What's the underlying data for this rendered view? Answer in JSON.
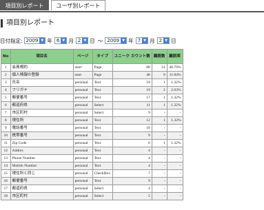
{
  "tabs": [
    {
      "label": "項目別レポート"
    },
    {
      "label": "ユーザ別レポート"
    }
  ],
  "page_title": "項目別レポート",
  "date_filter": {
    "label": "日付指定:",
    "from": {
      "year": "2009",
      "month": "6",
      "day": "2"
    },
    "separator": "～",
    "to": {
      "year": "2009",
      "month": "7",
      "day": "2"
    },
    "unit_year": "年",
    "unit_month": "月",
    "unit_day": "日"
  },
  "table": {
    "headers": [
      "No",
      "項目名",
      "ページ",
      "タイプ",
      "ユニーク カウント数",
      "離脱数",
      "離脱率"
    ],
    "rows": [
      [
        "1",
        "会員規約",
        "start",
        "Page",
        "88",
        "31",
        "40.79%"
      ],
      [
        "2",
        "個人情報の登録",
        "start",
        "Page",
        "46",
        "9",
        "11.84%"
      ],
      [
        "3",
        "氏名",
        "personal",
        "Text",
        "19",
        "1",
        "1.32%"
      ],
      [
        "4",
        "フリガナ",
        "personal",
        "Text",
        "19",
        "2",
        "2.63%"
      ],
      [
        "5",
        "郵便番号",
        "personal",
        "Text",
        "17",
        "1",
        "1.32%"
      ],
      [
        "6",
        "都道府県",
        "personal",
        "Select",
        "11",
        "1",
        "1.32%"
      ],
      [
        "7",
        "市区町村",
        "personal",
        "Select",
        "9",
        "-",
        "-"
      ],
      [
        "8",
        "現住所",
        "personal",
        "Text",
        "12",
        "1",
        "1.32%"
      ],
      [
        "9",
        "電話番号",
        "personal",
        "Text",
        "10",
        "-",
        "-"
      ],
      [
        "10",
        "携帯番号",
        "personal",
        "Text",
        "9",
        "-",
        "-"
      ],
      [
        "11",
        "Zip Code",
        "personal",
        "Text",
        "6",
        "1",
        "1.32%"
      ],
      [
        "12",
        "Addres",
        "personal",
        "Text",
        "4",
        "-",
        "-"
      ],
      [
        "13",
        "Phone Number",
        "personal",
        "Text",
        "4",
        "-",
        "-"
      ],
      [
        "14",
        "Mobile Number",
        "personal",
        "Text",
        "4",
        "-",
        "-"
      ],
      [
        "15",
        "現住所と同じ",
        "personal",
        "CheckBox",
        "7",
        "-",
        "-"
      ],
      [
        "16",
        "郵便番号",
        "personal",
        "Text",
        "9",
        "-",
        "-"
      ],
      [
        "17",
        "都道府県",
        "personal",
        "Select",
        "4",
        "-",
        "-"
      ],
      [
        "18",
        "市区町村",
        "personal",
        "Select",
        "5",
        "-",
        "-"
      ]
    ]
  },
  "colors": {
    "header_green": "#8dd08d",
    "active_tab": "#595959",
    "select_arrow": "#4a7fd8"
  }
}
